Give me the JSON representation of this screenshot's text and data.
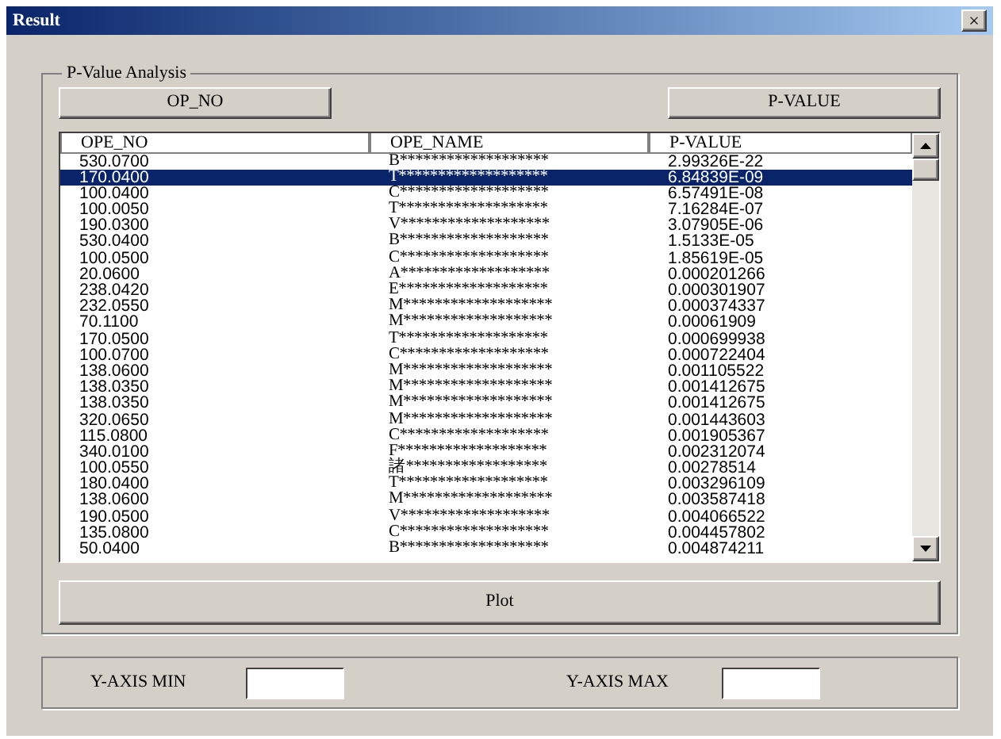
{
  "window": {
    "title": "Result",
    "close": "×"
  },
  "group": {
    "title": "P-Value Analysis"
  },
  "sort_buttons": [
    "OP_NO",
    "P-VALUE"
  ],
  "table": {
    "columns": [
      "OPE_NO",
      "OPE_NAME",
      "P-VALUE"
    ],
    "rows": [
      {
        "cells": [
          "530.0700",
          "B*******************",
          "2.99326E-22"
        ],
        "selected": false
      },
      {
        "cells": [
          "170.0400",
          "T*******************",
          "6.84839E-09"
        ],
        "selected": true
      },
      {
        "cells": [
          "100.0400",
          "C*******************",
          "6.57491E-08"
        ],
        "selected": false
      },
      {
        "cells": [
          "100.0050",
          "T*******************",
          "7.16284E-07"
        ],
        "selected": false
      },
      {
        "cells": [
          "190.0300",
          "V*******************",
          "3.07905E-06"
        ],
        "selected": false
      },
      {
        "cells": [
          "530.0400",
          "B*******************",
          "1.5133E-05"
        ],
        "selected": false
      },
      {
        "cells": [
          "100.0500",
          "C*******************",
          "1.85619E-05"
        ],
        "selected": false
      },
      {
        "cells": [
          "20.0600",
          "A*******************",
          "0.000201266"
        ],
        "selected": false
      },
      {
        "cells": [
          "238.0420",
          "E*******************",
          "0.000301907"
        ],
        "selected": false
      },
      {
        "cells": [
          "232.0550",
          "M*******************",
          "0.000374337"
        ],
        "selected": false
      },
      {
        "cells": [
          "70.1100",
          "M*******************",
          "0.00061909"
        ],
        "selected": false
      },
      {
        "cells": [
          "170.0500",
          "T*******************",
          "0.000699938"
        ],
        "selected": false
      },
      {
        "cells": [
          "100.0700",
          "C*******************",
          "0.000722404"
        ],
        "selected": false
      },
      {
        "cells": [
          "138.0600",
          "M*******************",
          "0.001105522"
        ],
        "selected": false
      },
      {
        "cells": [
          "138.0350",
          "M*******************",
          "0.001412675"
        ],
        "selected": false
      },
      {
        "cells": [
          "138.0350",
          "M*******************",
          "0.001412675"
        ],
        "selected": false
      },
      {
        "cells": [
          "320.0650",
          "M*******************",
          "0.001443603"
        ],
        "selected": false
      },
      {
        "cells": [
          "115.0800",
          "C*******************",
          "0.001905367"
        ],
        "selected": false
      },
      {
        "cells": [
          "340.0100",
          "F*******************",
          "0.002312074"
        ],
        "selected": false
      },
      {
        "cells": [
          "100.0550",
          "諸******************",
          "0.00278514"
        ],
        "selected": false
      },
      {
        "cells": [
          "180.0400",
          "T*******************",
          "0.003296109"
        ],
        "selected": false
      },
      {
        "cells": [
          "138.0600",
          "M*******************",
          "0.003587418"
        ],
        "selected": false
      },
      {
        "cells": [
          "190.0500",
          "V*******************",
          "0.004066522"
        ],
        "selected": false
      },
      {
        "cells": [
          "135.0800",
          "C*******************",
          "0.004457802"
        ],
        "selected": false
      },
      {
        "cells": [
          "50.0400",
          "B*******************",
          "0.004874211"
        ],
        "selected": false
      }
    ]
  },
  "plot_button": "Plot",
  "axis": [
    {
      "label": "Y-AXIS MIN"
    },
    {
      "label": "Y-AXIS MAX"
    }
  ]
}
